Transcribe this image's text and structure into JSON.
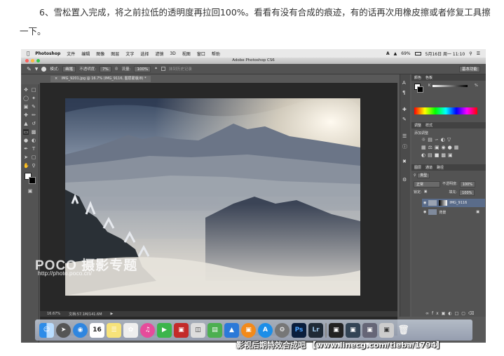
{
  "article": {
    "paragraph": "6、雪松置入完成，将之前拉低的透明度再拉回100%。看看有没有合成的痕迹，有的话再次用橡皮擦或者修复工具擦一下。"
  },
  "menubar": {
    "app": "Photoshop",
    "items": [
      "文件",
      "编辑",
      "图像",
      "图层",
      "文字",
      "选择",
      "滤镜",
      "3D",
      "视图",
      "窗口",
      "帮助"
    ],
    "battery": "69%",
    "datetime": "5月16日 周一 11:10"
  },
  "window": {
    "title": "Adobe Photoshop CS6"
  },
  "options": {
    "mode_label": "模式:",
    "mode_value": "画笔",
    "opacity_label": "不透明度:",
    "opacity_value": "7%",
    "flow_label": "流量:",
    "flow_value": "100%",
    "erase_history": "抹到历史记录",
    "workspace": "基本功能"
  },
  "document": {
    "tab": "IMG_9201.jpg @ 16.7% (IMG_9116, 图层蒙版/8) *",
    "zoom": "16.67%",
    "doc_size": "文档:57.1M/141.6M"
  },
  "panels": {
    "color_tabs": [
      "颜色",
      "色板"
    ],
    "k_label": "K",
    "k_value": "%",
    "adjust_tabs": [
      "调整",
      "样式"
    ],
    "adjust_title": "添加调整",
    "layers_tabs": [
      "图层",
      "通道",
      "路径"
    ],
    "kind": "类型",
    "blend_mode": "正常",
    "opacity_label": "不透明度:",
    "opacity_value": "100%",
    "lock_label": "锁定:",
    "fill_label": "填充:",
    "fill_value": "100%",
    "layers": [
      {
        "name": "IMG_9116"
      },
      {
        "name": "背景"
      }
    ]
  },
  "dock": {
    "labels": [
      "Ps",
      "Lr",
      "16"
    ]
  },
  "watermark": {
    "poco": "POCO 摄影专题",
    "url": "http://photo.poco.cn/"
  },
  "caption": "影视后期特效合成吧 【www.linecg.com/tieba/1794】",
  "colors": {
    "ps_bg": "#535353",
    "canvas_bg": "#282828",
    "selection": "#5a6c8a"
  }
}
